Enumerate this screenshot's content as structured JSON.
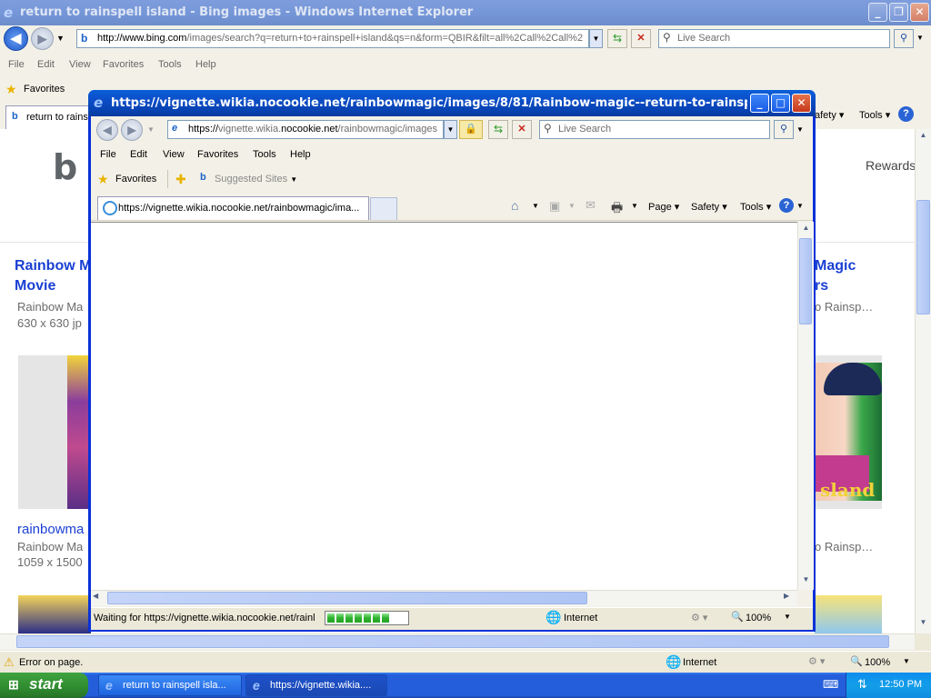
{
  "main_window": {
    "title": "return to rainspell island - Bing images - Windows Internet Explorer",
    "address_host": "http://www.bing.com",
    "address_rest": "/images/search?q=return+to+rainspell+island&qs=n&form=QBIR&filt=all%2Call%2Call%2",
    "search_placeholder": "Live Search",
    "menu": [
      "File",
      "Edit",
      "View",
      "Favorites",
      "Tools",
      "Help"
    ],
    "favorites_label": "Favorites",
    "tab_label": "return to rains",
    "right_cmd": {
      "safety": "afety",
      "tools": "Tools"
    },
    "status_text": "Error on page.",
    "zone": "Internet",
    "zoom": "100%"
  },
  "bing": {
    "rewards": "Rewards",
    "left": {
      "title_line1": "Rainbow M",
      "title_line2": "Movie",
      "sub1": "Rainbow Ma",
      "dims1": "630 x 630 jp",
      "link": "rainbowma",
      "sub2": "Rainbow Ma",
      "dims2": "1059 x 1500"
    },
    "right": {
      "title_line1": "Magic",
      "title_line2": "rs",
      "sub1": "o Rainsp…",
      "sub2": "o Rainsp…",
      "art_text": "sland"
    }
  },
  "popup": {
    "title": "https://vignette.wikia.nocookie.net/rainbowmagic/images/8/81/Rainbow-magic--return-to-rainspell - Windows...",
    "address_prefix": "https://",
    "address_host_dim": "vignette.wikia.",
    "address_host": "nocookie.net",
    "address_rest": "/rainbowmagic/images",
    "search_placeholder": "Live Search",
    "menu": [
      "File",
      "Edit",
      "View",
      "Favorites",
      "Tools",
      "Help"
    ],
    "favorites_label": "Favorites",
    "suggested_sites": "Suggested Sites",
    "tab_label": "https://vignette.wikia.nocookie.net/rainbowmagic/ima...",
    "cmd": {
      "page": "Page",
      "safety": "Safety",
      "tools": "Tools"
    },
    "status_text": "Waiting for https://vignette.wikia.nocookie.net/rainl",
    "progress_segments": 7,
    "zone": "Internet",
    "zoom": "100%"
  },
  "taskbar": {
    "start": "start",
    "tasks": [
      "return to rainspell isla...",
      "https://vignette.wikia...."
    ],
    "clock": "12:50 PM"
  },
  "colors": {
    "xp_blue": "#0a4fc5",
    "link_blue": "#1a3fd3",
    "taskbar": "#245edb",
    "start_green": "#2f8b2f"
  }
}
